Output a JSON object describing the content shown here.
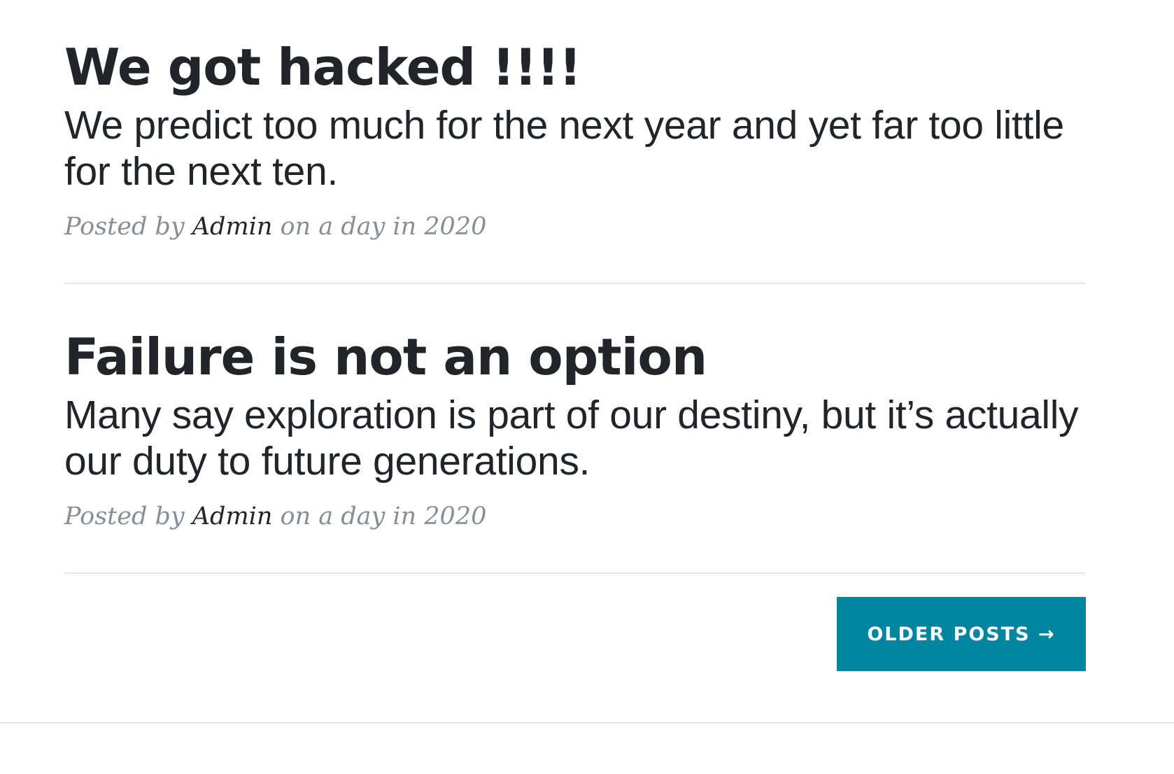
{
  "posts": [
    {
      "title": "We got hacked !!!!",
      "subtitle": "We predict too much for the next year and yet far too little for the next ten.",
      "meta_prefix": "Posted by ",
      "author": "Admin",
      "meta_suffix": " on a day in 2020"
    },
    {
      "title": "Failure is not an option",
      "subtitle": "Many say exploration is part of our destiny, but it’s actually our duty to future generations.",
      "meta_prefix": "Posted by ",
      "author": "Admin",
      "meta_suffix": " on a day in 2020"
    }
  ],
  "pager": {
    "older_label": "OLDER POSTS →"
  },
  "colors": {
    "accent": "#0085a1",
    "text": "#212529",
    "muted": "#868e96",
    "divider": "#e4e6e8"
  }
}
